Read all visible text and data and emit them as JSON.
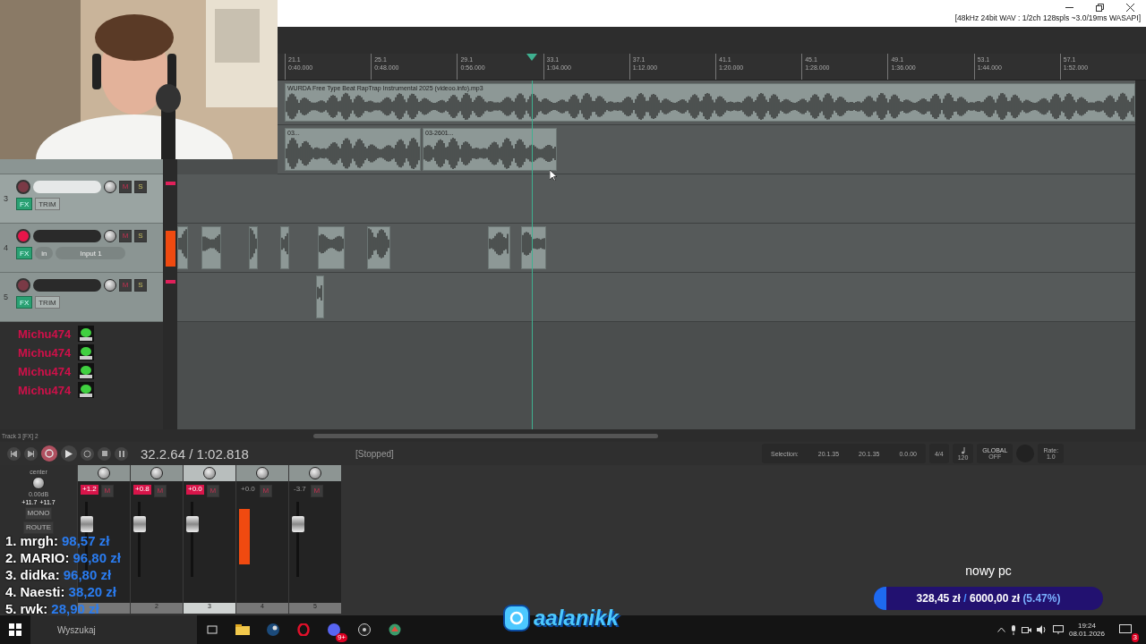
{
  "title_bar": {
    "audio_info": "[48kHz 24bit WAV : 1/2ch 128spls ~3.0/19ms WASAPI]"
  },
  "ruler": {
    "marks": [
      {
        "bar": "21.1",
        "time": "0:40.000"
      },
      {
        "bar": "25.1",
        "time": "0:48.000"
      },
      {
        "bar": "29.1",
        "time": "0:56.000"
      },
      {
        "bar": "33.1",
        "time": "1:04.000"
      },
      {
        "bar": "37.1",
        "time": "1:12.000"
      },
      {
        "bar": "41.1",
        "time": "1:20.000"
      },
      {
        "bar": "45.1",
        "time": "1:28.000"
      },
      {
        "bar": "49.1",
        "time": "1:36.000"
      },
      {
        "bar": "53.1",
        "time": "1:44.000"
      },
      {
        "bar": "57.1",
        "time": "1:52.000"
      }
    ]
  },
  "tracks": [
    {
      "clips": [
        {
          "label": "WURDA Free Type Beat RapTrap Instrumental 2025 (videoo.info).mp3"
        }
      ]
    },
    {
      "clips": [
        {
          "label": "03..."
        },
        {
          "label": "03-2601..."
        }
      ]
    },
    {
      "number": "3",
      "selected": true,
      "armed": false,
      "kind": "trim",
      "fx": "FX",
      "mute": "M",
      "solo": "S",
      "trim": "TRIM"
    },
    {
      "number": "4",
      "selected": false,
      "armed": true,
      "kind": "input",
      "fx": "FX",
      "mute": "M",
      "solo": "S",
      "input_mode": "in",
      "input": "Input 1"
    },
    {
      "number": "5",
      "selected": false,
      "armed": false,
      "kind": "trim",
      "fx": "FX",
      "mute": "M",
      "solo": "S",
      "trim": "TRIM"
    }
  ],
  "status": "Track 3 [FX] 2",
  "transport": {
    "time": "32.2.64 / 1:02.818",
    "state": "[Stopped]",
    "selection_label": "Selection:",
    "start": "20.1.35",
    "end": "20.1.35",
    "length": "0.0.00",
    "signature": "4/4",
    "tempo": "120",
    "automation": "GLOBAL",
    "automation_state": "OFF",
    "rate_label": "Rate:",
    "rate": "1.0"
  },
  "mixer": {
    "master": {
      "pan": "center",
      "volume": "0.00dB",
      "mono": "MONO",
      "route": "ROUTE",
      "peak_left": "+11.7",
      "peak_right": "+11.7"
    },
    "strips": [
      {
        "gain": "+1.2",
        "highlighted": true,
        "armed": false,
        "selected": false,
        "mute": "M"
      },
      {
        "gain": "+0.8",
        "highlighted": true,
        "armed": false,
        "selected": false,
        "mute": "M",
        "number": "2"
      },
      {
        "gain": "+0.0",
        "highlighted": true,
        "armed": false,
        "selected": true,
        "mute": "M",
        "number": "3"
      },
      {
        "gain": "+0.0",
        "highlighted": false,
        "armed": true,
        "selected": false,
        "mute": "M",
        "number": "4"
      },
      {
        "gain": "-3.7",
        "highlighted": false,
        "armed": false,
        "selected": false,
        "mute": "M",
        "number": "5"
      }
    ]
  },
  "chat": [
    {
      "name": "Michu474"
    },
    {
      "name": "Michu474"
    },
    {
      "name": "Michu474"
    },
    {
      "name": "Michu474"
    }
  ],
  "leaderboard": [
    {
      "rank": "1.",
      "name": "mrgh:",
      "amount": "98,57 zł"
    },
    {
      "rank": "2.",
      "name": "MARIO:",
      "amount": "96,80 zł"
    },
    {
      "rank": "3.",
      "name": "didka:",
      "amount": "96,80 zł"
    },
    {
      "rank": "4.",
      "name": "Naesti:",
      "amount": "38,20 zł"
    },
    {
      "rank": "5.",
      "name": "rwk:",
      "amount": "28,90 zł"
    }
  ],
  "social": {
    "handle": "aalanikk"
  },
  "goal": {
    "title": "nowy pc",
    "raised": "328,45 zł",
    "separator": "/",
    "target": "6000,00 zł",
    "percent": "(5.47%)",
    "level": 0.0547
  },
  "taskbar": {
    "search_placeholder": "Wyszukaj",
    "discord_badge": "9+",
    "time": "19:24",
    "date": "08.01.2026",
    "notifications": "3"
  }
}
